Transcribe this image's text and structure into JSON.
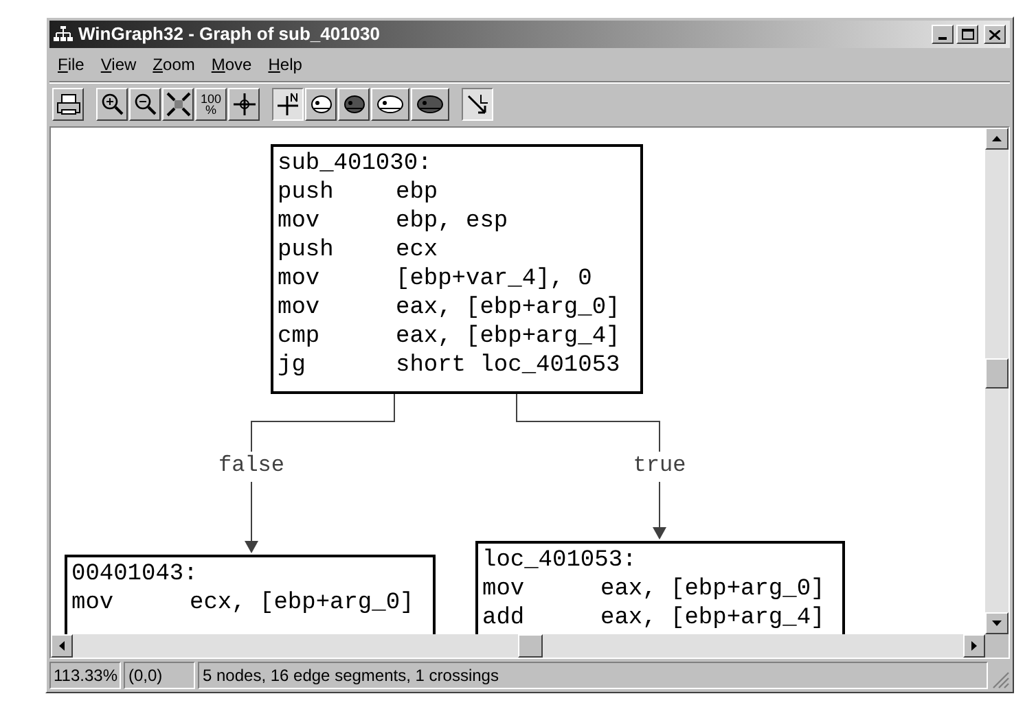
{
  "window": {
    "title": "WinGraph32 - Graph of sub_401030"
  },
  "menu": [
    {
      "label": "File"
    },
    {
      "label": "View"
    },
    {
      "label": "Zoom"
    },
    {
      "label": "Move"
    },
    {
      "label": "Help"
    }
  ],
  "toolbar": [
    {
      "buttons": [
        {
          "kind": "print",
          "pressed": false
        }
      ]
    },
    {
      "buttons": [
        {
          "kind": "zoom-in",
          "pressed": false
        },
        {
          "kind": "zoom-out",
          "pressed": false
        },
        {
          "kind": "fit",
          "pressed": false
        },
        {
          "kind": "zoom-100",
          "pressed": false,
          "label": "100",
          "sub": "%"
        },
        {
          "kind": "center",
          "pressed": false
        }
      ]
    },
    {
      "buttons": [
        {
          "kind": "north",
          "pressed": true
        },
        {
          "kind": "fish-outline",
          "pressed": false
        },
        {
          "kind": "fish-filled",
          "pressed": false
        },
        {
          "kind": "fish-wide",
          "pressed": false
        },
        {
          "kind": "fish-wide-filled",
          "pressed": false
        }
      ]
    },
    {
      "buttons": [
        {
          "kind": "edge-arrow",
          "pressed": true
        }
      ]
    }
  ],
  "graph": {
    "nodes": [
      {
        "title": "sub_401030:",
        "lines": [
          {
            "op": "push",
            "args": "ebp"
          },
          {
            "op": "mov",
            "args": "ebp, esp"
          },
          {
            "op": "push",
            "args": "ecx"
          },
          {
            "op": "mov",
            "args": "[ebp+var_4], 0"
          },
          {
            "op": "mov",
            "args": "eax, [ebp+arg_0]"
          },
          {
            "op": "cmp",
            "args": "eax, [ebp+arg_4]"
          },
          {
            "op": "jg",
            "args": "short loc_401053"
          }
        ]
      },
      {
        "title": "00401043:",
        "lines": [
          {
            "op": "mov",
            "args": "ecx, [ebp+arg_0]"
          }
        ]
      },
      {
        "title": "loc_401053:",
        "lines": [
          {
            "op": "mov",
            "args": "eax, [ebp+arg_0]"
          },
          {
            "op": "add",
            "args": "eax, [ebp+arg_4]"
          }
        ]
      }
    ],
    "edges": [
      {
        "label": "false"
      },
      {
        "label": "true"
      }
    ]
  },
  "status_bar": {
    "zoom": "113.33%",
    "position": "(0,0)",
    "info": "5 nodes, 16 edge segments, 1 crossings"
  }
}
